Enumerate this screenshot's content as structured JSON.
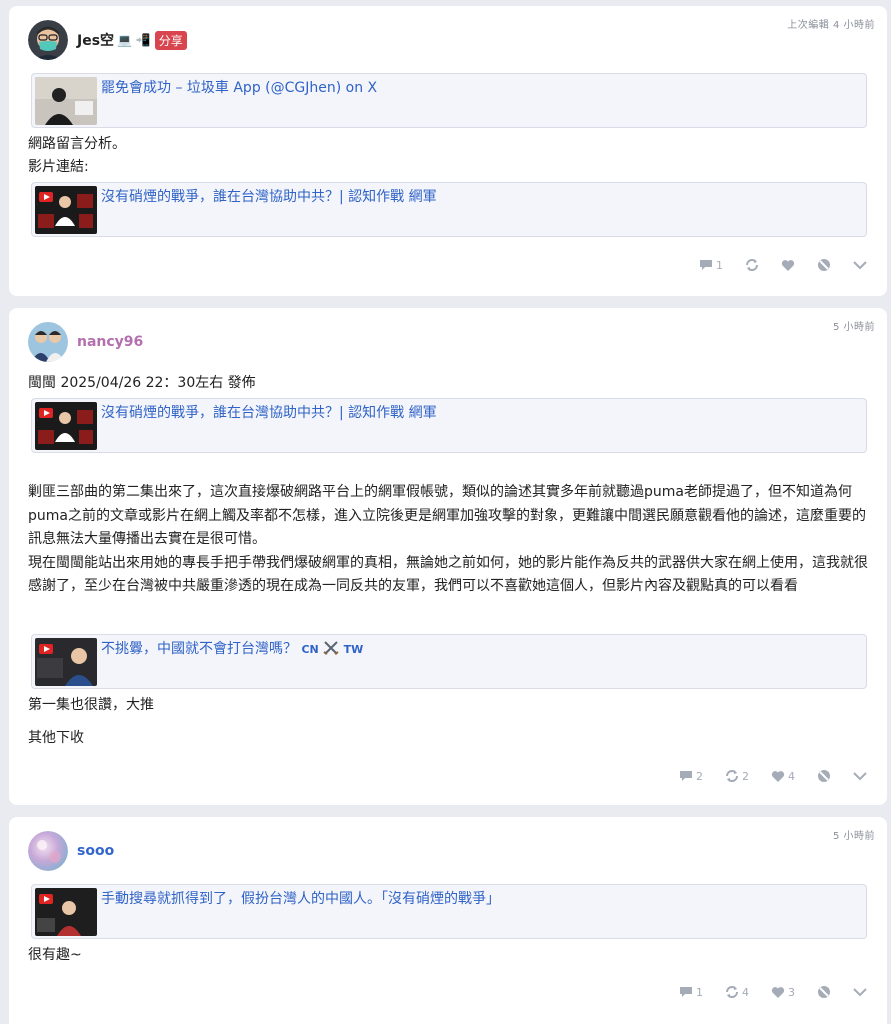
{
  "posts": [
    {
      "time": "上次編輯 4 小時前",
      "author": "Jes空",
      "author_icons": "💻 📲",
      "share_label": "分享",
      "embed_top": {
        "title": "罷免會成功 – 垃圾車 App (@CGJhen) on X"
      },
      "lines": [
        "網路留言分析。",
        "影片連結:"
      ],
      "embed_video": {
        "title": "沒有硝煙的戰爭，誰在台灣協助中共？| 認知作戰 網軍"
      },
      "counts": {
        "replies": "1",
        "reposts": "",
        "likes": ""
      }
    },
    {
      "time": "5 小時前",
      "author": "nancy96",
      "line_top": "閩閩 2025/04/26 22：30左右 發佈",
      "embed_video": {
        "title": "沒有硝煙的戰爭，誰在台灣協助中共？| 認知作戰 網軍"
      },
      "paragraph1": "剿匪三部曲的第二集出來了，這次直接爆破網路平台上的網軍假帳號，類似的論述其實多年前就聽過puma老師提過了，但不知道為何puma之前的文章或影片在網上觸及率都不怎樣，進入立院後更是網軍加強攻擊的對象，更難讓中間選民願意觀看他的論述，這麼重要的訊息無法大量傳播出去實在是很可惜。",
      "paragraph2": "現在閩閩能站出來用她的專長手把手帶我們爆破網軍的真相，無論她之前如何，她的影片能作為反共的武器供大家在網上使用，這我就很感謝了，至少在台灣被中共嚴重滲透的現在成為一同反共的友軍，我們可以不喜歡她這個人，但影片內容及觀點真的可以看看",
      "embed_video2": {
        "title": "不挑釁，中國就不會打台灣嗎？",
        "suffix_cn": "CN",
        "suffix_tw": "TW"
      },
      "line_after1": "第一集也很讚，大推",
      "line_after2": "其他下收",
      "counts": {
        "replies": "2",
        "reposts": "2",
        "likes": "4"
      }
    },
    {
      "time": "5 小時前",
      "author": "sooo",
      "embed_video": {
        "title": "手動搜尋就抓得到了，假扮台灣人的中國人。「沒有硝煙的戰爭」"
      },
      "line_after": "很有趣~",
      "counts": {
        "replies": "1",
        "reposts": "4",
        "likes": "3"
      }
    }
  ],
  "colors": {
    "link": "#2f63c7",
    "share_badge": "#d9454e",
    "author_dark": "#222222",
    "author_pink": "#b36fae",
    "author_blue": "#3366cc",
    "action_gray": "#a6abb8"
  },
  "icons": [
    "reply-icon",
    "repost-icon",
    "heart-icon",
    "block-icon",
    "chevron-down-icon",
    "play-icon",
    "crossed-swords-icon"
  ]
}
